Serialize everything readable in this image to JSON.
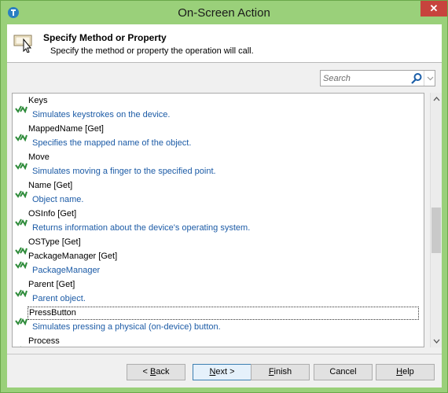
{
  "window": {
    "title": "On-Screen Action",
    "close_label": "✕"
  },
  "header": {
    "title": "Specify Method or Property",
    "subtitle": "Specify the method or property the operation will call."
  },
  "search": {
    "placeholder": "Search"
  },
  "items": [
    {
      "name": "Keys",
      "desc": "Simulates keystrokes on the device."
    },
    {
      "name": "MappedName [Get]",
      "desc": "Specifies the mapped name of the object."
    },
    {
      "name": "Move",
      "desc": "Simulates moving a finger to the specified point."
    },
    {
      "name": "Name [Get]",
      "desc": "Object name."
    },
    {
      "name": "OSInfo [Get]",
      "desc": "Returns information about the device's operating system."
    },
    {
      "name": "OSType [Get]",
      "desc": ""
    },
    {
      "name": "PackageManager [Get]",
      "desc": "PackageManager"
    },
    {
      "name": "Parent [Get]",
      "desc": "Parent object."
    },
    {
      "name": "PressButton",
      "desc": "Simulates pressing a physical (on-device) button.",
      "selected": true
    },
    {
      "name": "Process",
      "desc": ""
    }
  ],
  "buttons": {
    "back": {
      "prefix": "< ",
      "underline": "B",
      "rest": "ack"
    },
    "next": {
      "underline": "N",
      "rest": "ext >"
    },
    "finish": {
      "underline": "F",
      "rest": "inish"
    },
    "cancel": "Cancel",
    "help": {
      "underline": "H",
      "rest": "elp"
    }
  }
}
